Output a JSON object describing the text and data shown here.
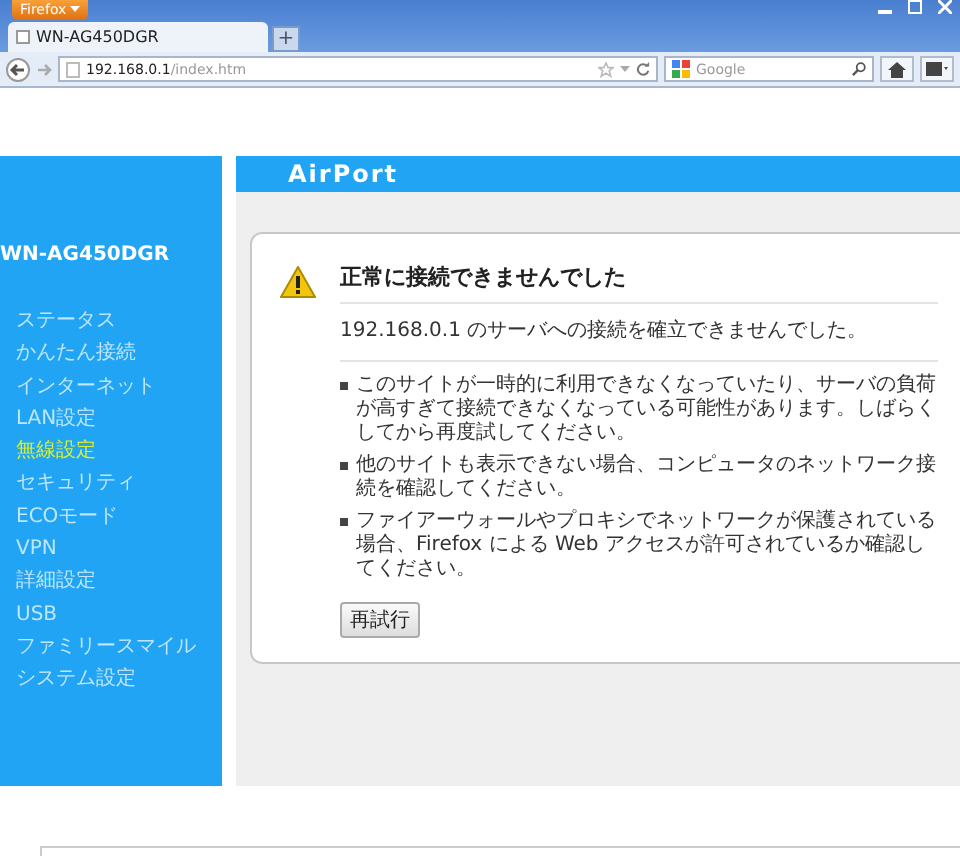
{
  "browser": {
    "menu_button": "Firefox",
    "tab": {
      "title": "WN-AG450DGR"
    },
    "new_tab": "+",
    "address": {
      "host": "192.168.0.1",
      "path": "/index.htm"
    },
    "search": {
      "placeholder": "Google"
    }
  },
  "sidebar": {
    "title": "WN-AG450DGR",
    "items": [
      {
        "label": "ステータス",
        "selected": false
      },
      {
        "label": "かんたん接続",
        "selected": false
      },
      {
        "label": "インターネット",
        "selected": false
      },
      {
        "label": "LAN設定",
        "selected": false
      },
      {
        "label": "無線設定",
        "selected": true
      },
      {
        "label": "セキュリティ",
        "selected": false
      },
      {
        "label": "ECOモード",
        "selected": false
      },
      {
        "label": "VPN",
        "selected": false
      },
      {
        "label": "詳細設定",
        "selected": false
      },
      {
        "label": "USB",
        "selected": false
      },
      {
        "label": "ファミリースマイル",
        "selected": false
      },
      {
        "label": "システム設定",
        "selected": false
      }
    ]
  },
  "header": {
    "logo": "AirPort"
  },
  "error": {
    "title": "正常に接続できませんでした",
    "message": "192.168.0.1 のサーバへの接続を確立できませんでした。",
    "bullets": [
      "このサイトが一時的に利用できなくなっていたり、サーバの負荷が高すぎて接続できなくなっている可能性があります。しばらくしてから再度試してください。",
      "他のサイトも表示できない場合、コンピュータのネットワーク接続を確認してください。",
      "ファイアーウォールやプロキシでネットワークが保護されている場合、Firefox による Web アクセスが許可されているか確認してください。"
    ],
    "retry_button": "再試行"
  }
}
